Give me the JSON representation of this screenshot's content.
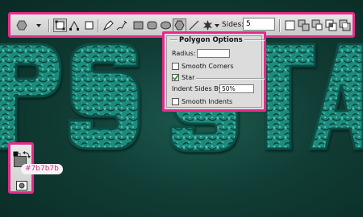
{
  "background": {
    "headline_text": "PS STA",
    "colors": {
      "dark": "#0a2a25",
      "mid": "#1d5a4e",
      "letter_fill": "#1f8a7b",
      "letter_edge": "#0f4e45",
      "highlight": "#e8298a"
    }
  },
  "toolbar": {
    "tools": [
      {
        "icon": "polygon-tool-preset-icon"
      },
      {
        "icon": "dropdown-arrow-icon"
      },
      {
        "icon": "shape-layers-icon"
      },
      {
        "icon": "paths-icon"
      },
      {
        "icon": "fill-pixels-icon"
      },
      {
        "icon": "pen-icon"
      },
      {
        "icon": "freeform-pen-icon"
      },
      {
        "icon": "rectangle-icon"
      },
      {
        "icon": "rounded-rectangle-icon"
      },
      {
        "icon": "ellipse-icon"
      },
      {
        "icon": "polygon-icon"
      },
      {
        "icon": "line-icon"
      },
      {
        "icon": "custom-shape-icon"
      },
      {
        "icon": "geometry-options-dropdown-icon"
      }
    ],
    "sides_label": "Sides:",
    "sides_value": "5",
    "path_ops": [
      "new-layer-icon",
      "add-to-shape-icon",
      "subtract-icon",
      "intersect-icon",
      "exclude-icon"
    ]
  },
  "polygon_options": {
    "title": "Polygon Options",
    "radius_label": "Radius:",
    "radius_value": "",
    "smooth_corners_label": "Smooth Corners",
    "smooth_corners_checked": false,
    "star_label": "Star",
    "star_checked": true,
    "indent_label": "Indent Sides By:",
    "indent_value": "50%",
    "smooth_indents_label": "Smooth Indents",
    "smooth_indents_checked": false
  },
  "color_tools": {
    "foreground_hex": "#7b7b7b",
    "tooltip": "#7b7b7b",
    "icons": [
      "default-colors-icon",
      "swap-colors-icon",
      "quick-mask-icon"
    ]
  }
}
